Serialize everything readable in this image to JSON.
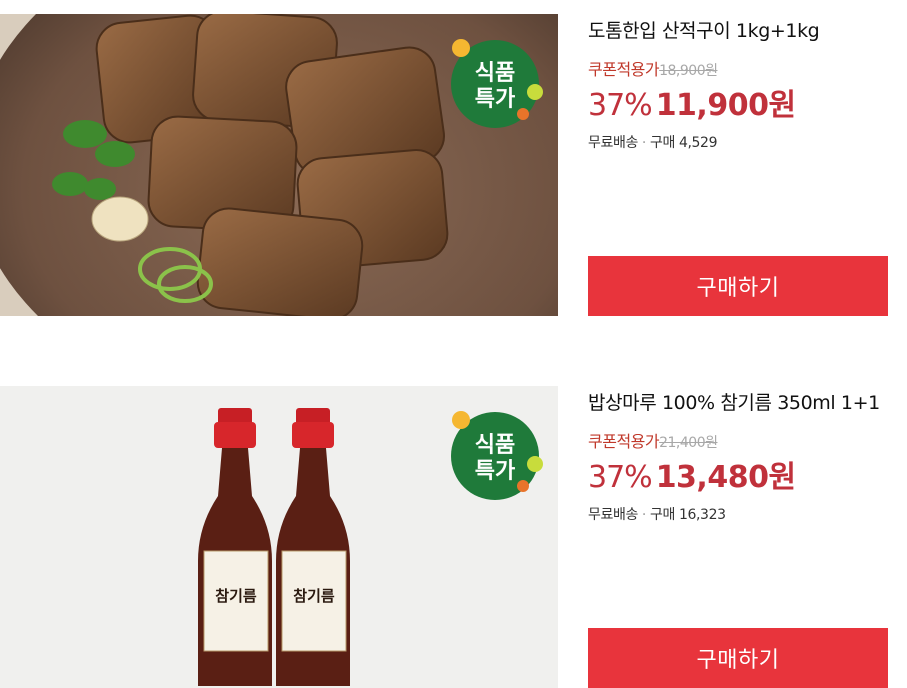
{
  "products": [
    {
      "title": "도톰한입 산적구이 1kg+1kg",
      "coupon_label": "쿠폰적용가",
      "original_price": "18,900원",
      "discount_rate": "37%",
      "sale_price": "11,900원",
      "shipping": "무료배송",
      "purchase_label": "구매 4,529",
      "badge_line1": "식품",
      "badge_line2": "특가",
      "buy_label": "구매하기",
      "image_icon": "grilled-meat-patties-image"
    },
    {
      "title": "밥상마루 100% 참기름 350ml 1+1",
      "coupon_label": "쿠폰적용가",
      "original_price": "21,400원",
      "discount_rate": "37%",
      "sale_price": "13,480원",
      "shipping": "무료배송",
      "purchase_label": "구매 16,323",
      "badge_line1": "식품",
      "badge_line2": "특가",
      "buy_label": "구매하기",
      "bottle_label": "참기름",
      "image_icon": "sesame-oil-bottles-image"
    }
  ],
  "colors": {
    "accent": "#e8343c",
    "price": "#c0313b",
    "badge_green": "#1f7a3a"
  }
}
